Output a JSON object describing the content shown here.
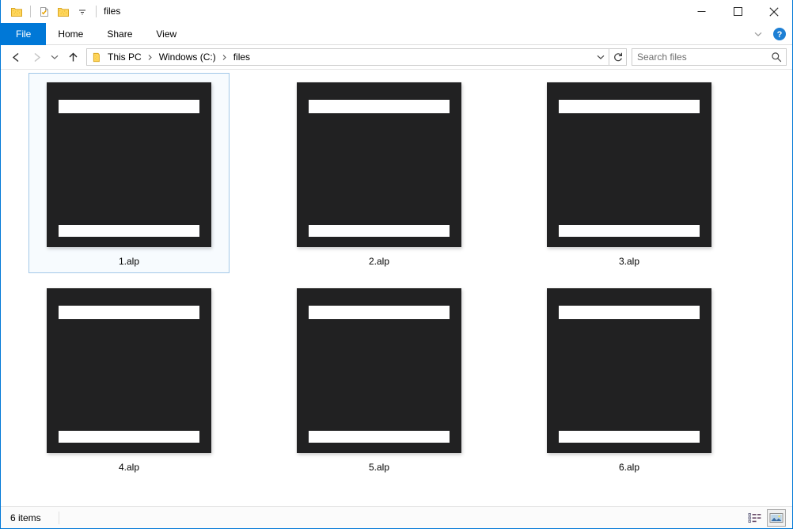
{
  "window": {
    "title": "files",
    "quick_access": [
      {
        "name": "folder-icon",
        "label": "Folder"
      },
      {
        "name": "properties-icon",
        "label": "Properties"
      },
      {
        "name": "new-folder-icon",
        "label": "New folder"
      },
      {
        "name": "customize-qat-dropdown-icon",
        "label": "Customize Quick Access Toolbar"
      }
    ],
    "controls": {
      "minimize": "Minimize",
      "maximize": "Maximize",
      "close": "Close"
    }
  },
  "ribbon": {
    "tabs": [
      {
        "label": "File",
        "selected": true
      },
      {
        "label": "Home",
        "selected": false
      },
      {
        "label": "Share",
        "selected": false
      },
      {
        "label": "View",
        "selected": false
      }
    ],
    "collapse_label": "Minimize the Ribbon",
    "help_label": "Help",
    "help_glyph": "?"
  },
  "navigation": {
    "back_label": "Back",
    "forward_label": "Forward",
    "recent_label": "Recent locations",
    "up_label": "Up",
    "refresh_label": "Refresh",
    "breadcrumb": [
      "This PC",
      "Windows (C:)",
      "files"
    ],
    "breadcrumb_separator": "›",
    "dropdown_label": "Previous locations"
  },
  "search": {
    "placeholder": "Search files",
    "value": ""
  },
  "files": [
    {
      "name": "1.alp",
      "selected": true
    },
    {
      "name": "2.alp",
      "selected": false
    },
    {
      "name": "3.alp",
      "selected": false
    },
    {
      "name": "4.alp",
      "selected": false
    },
    {
      "name": "5.alp",
      "selected": false
    },
    {
      "name": "6.alp",
      "selected": false
    }
  ],
  "status": {
    "item_count": "6 items",
    "details_view_label": "Details view",
    "large_icons_view_label": "Large icons view",
    "active_view": "large-icons"
  },
  "colors": {
    "accent": "#0078d7",
    "selection_border": "#a3c8e8",
    "selection_fill": "#f7fbfe",
    "thumbnail_bg": "#212122",
    "thumbnail_bar": "#ffffff",
    "folder_yellow": "#ffd65c"
  }
}
